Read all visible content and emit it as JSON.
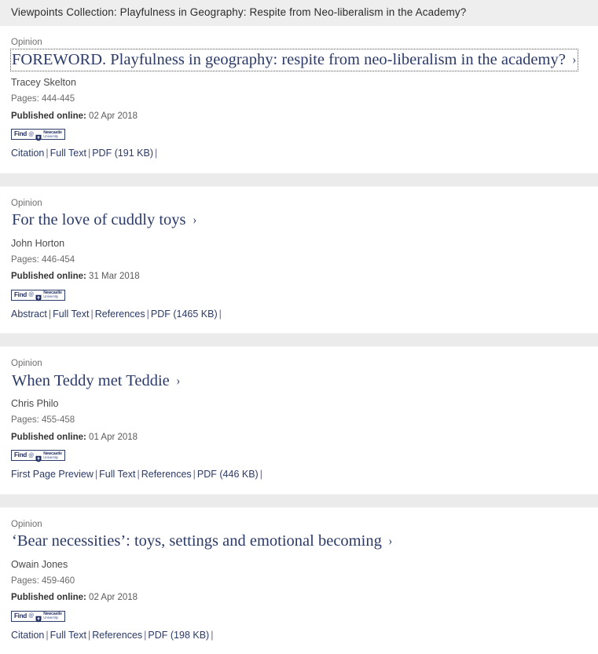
{
  "header": {
    "title": "Viewpoints Collection: Playfulness in Geography: Respite from Neo-liberalism in the Academy?"
  },
  "badge": {
    "find_label": "Find",
    "at_symbol": "@",
    "university_line1": "Newcastle",
    "university_line2": "University"
  },
  "labels": {
    "published_online": "Published online:",
    "chevron": "›",
    "separator": "|"
  },
  "articles": [
    {
      "type": "Opinion",
      "title": "FOREWORD. Playfulness in geography: respite from neo-liberalism in the academy?",
      "focused": true,
      "authors": "Tracey Skelton",
      "pages": "Pages: 444-445",
      "published_date": "02 Apr 2018",
      "links": [
        "Citation",
        "Full Text",
        "PDF (191 KB)"
      ]
    },
    {
      "type": "Opinion",
      "title": "For the love of cuddly toys",
      "focused": false,
      "authors": "John Horton",
      "pages": "Pages: 446-454",
      "published_date": "31 Mar 2018",
      "links": [
        "Abstract",
        "Full Text",
        "References",
        "PDF (1465 KB)"
      ]
    },
    {
      "type": "Opinion",
      "title": "When Teddy met Teddie",
      "focused": false,
      "authors": "Chris Philo",
      "pages": "Pages: 455-458",
      "published_date": "01 Apr 2018",
      "links": [
        "First Page Preview",
        "Full Text",
        "References",
        "PDF (446 KB)"
      ]
    },
    {
      "type": "Opinion",
      "title": "‘Bear necessities’: toys, settings and emotional becoming",
      "focused": false,
      "authors": "Owain Jones",
      "pages": "Pages: 459-460",
      "published_date": "02 Apr 2018",
      "links": [
        "Citation",
        "Full Text",
        "References",
        "PDF (198 KB)"
      ]
    }
  ],
  "colors": {
    "header_bg": "#eeeeee",
    "card_bg": "#ffffff",
    "gap_bg": "#ebebeb",
    "title": "#2b3a67",
    "link": "#2b3a67",
    "muted": "#6f6f6f"
  }
}
